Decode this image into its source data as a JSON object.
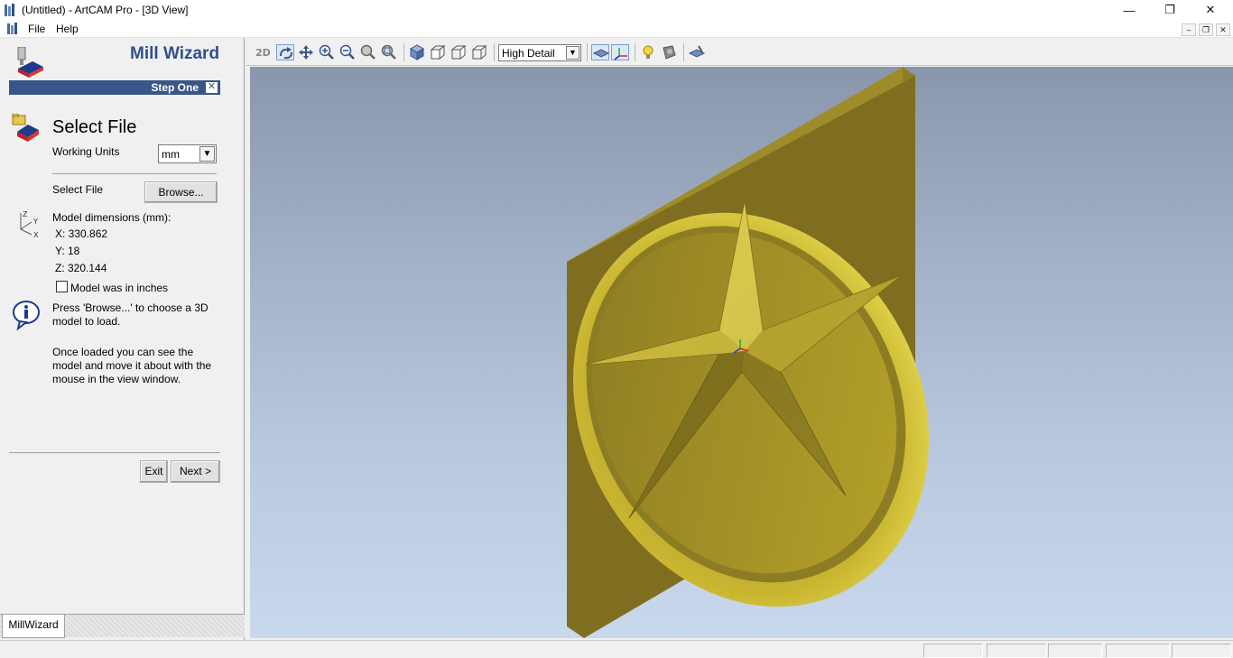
{
  "window": {
    "title": "(Untitled) - ArtCAM Pro - [3D View]",
    "minimize": "—",
    "restore": "❐",
    "close": "✕"
  },
  "menu": {
    "items": [
      "File",
      "Help"
    ],
    "mdi_minimize": "–",
    "mdi_restore": "❐",
    "mdi_close": "✕"
  },
  "wizard": {
    "title": "Mill Wizard",
    "step": "Step One",
    "step_close": "✕",
    "section_title": "Select File",
    "working_units_label": "Working Units",
    "working_units_value": "mm",
    "select_file_label": "Select File",
    "browse_button": "Browse...",
    "model_dims_label": "Model dimensions (mm):",
    "dim_x": "X:  330.862",
    "dim_y": "Y:  18",
    "dim_z": "Z:  320.144",
    "inches_checkbox_label": "Model was in inches",
    "inches_checked": false,
    "info_1": "Press 'Browse...' to choose a 3D model to load.",
    "info_2": "Once loaded you can see the model and move it about with the mouse in the view window.",
    "exit_button": "Exit",
    "next_button": "Next >",
    "axis_z": "Z",
    "axis_y": "Y",
    "axis_x": "X"
  },
  "tabs": {
    "active": "MillWizard"
  },
  "toolbar": {
    "icon_2d": "2D",
    "detail_value": "High Detail",
    "icons": [
      "2d-view-icon",
      "rotate-icon",
      "pan-icon",
      "zoom-in-icon",
      "zoom-out-icon",
      "zoom-box-icon",
      "zoom-fit-icon",
      "iso-view-icon",
      "front-view-icon",
      "side-view-icon",
      "top-view-icon",
      "detail-select",
      "show-plane-icon",
      "show-axes-icon",
      "light-icon",
      "material-icon",
      "render-icon"
    ]
  },
  "colors": {
    "accent": "#3a5588",
    "title_blue": "#2f4f8f",
    "model_gold": "#c9b42e",
    "model_dark": "#7d6c20"
  }
}
